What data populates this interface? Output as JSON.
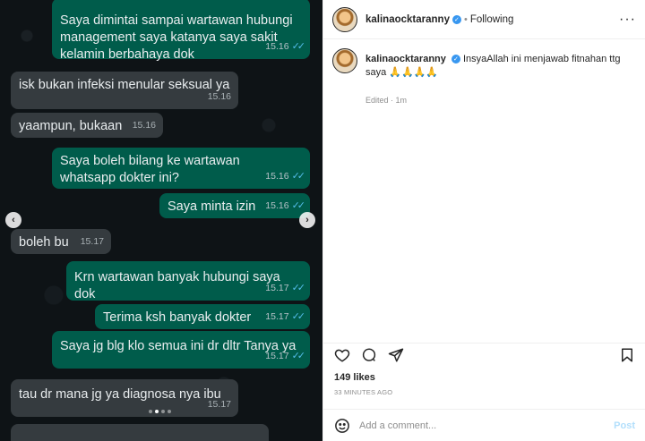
{
  "chat": {
    "messages": [
      {
        "dir": "out",
        "text": "Saya dimintai sampai wartawan hubungi management saya katanya saya sakit kelamin berbahaya dok",
        "time": "15.16",
        "read": true
      },
      {
        "dir": "in",
        "text": "isk bukan infeksi menular seksual ya",
        "time": "15.16"
      },
      {
        "dir": "in",
        "text": "yaampun, bukaan",
        "time": "15.16"
      },
      {
        "dir": "out",
        "text": "Saya boleh bilang ke wartawan whatsapp dokter ini?",
        "time": "15.16",
        "read": true
      },
      {
        "dir": "out",
        "text": "Saya minta izin",
        "time": "15.16",
        "read": true
      },
      {
        "dir": "in",
        "text": "boleh bu",
        "time": "15.17"
      },
      {
        "dir": "out",
        "text": "Krn wartawan banyak hubungi saya dok",
        "time": "15.17",
        "read": true
      },
      {
        "dir": "out",
        "text": "Terima ksh banyak dokter",
        "time": "15.17",
        "read": true
      },
      {
        "dir": "out",
        "text": "Saya jg blg klo semua ini dr dltr Tanya ya",
        "time": "15.17",
        "read": true
      },
      {
        "dir": "in",
        "text": "tau dr mana jg ya diagnosa nya ibu",
        "time": "15.17"
      }
    ],
    "ticks": "✓✓",
    "prev_icon": "‹",
    "next_icon": "›",
    "carousel_count": 4,
    "carousel_active": 1
  },
  "post": {
    "username": "kalinaocktaranny",
    "verified_glyph": "✓",
    "separator": "•",
    "following_label": "Following",
    "more_icon": "···",
    "caption_user": "kalinaocktaranny",
    "caption_text": "InsyaAllah ini menjawab fitnahan ttg saya 🙏🙏🙏🙏",
    "edited_label": "Edited · 1m",
    "likes": "149 likes",
    "posted_ago": "33 MINUTES AGO",
    "comment_placeholder": "Add a comment...",
    "post_label": "Post"
  },
  "colors": {
    "outgoing_bubble": "#005c4b",
    "incoming_bubble": "#353b3f",
    "read_ticks": "#53bdeb",
    "verified": "#3897f0",
    "post_button": "#b2dffc"
  }
}
